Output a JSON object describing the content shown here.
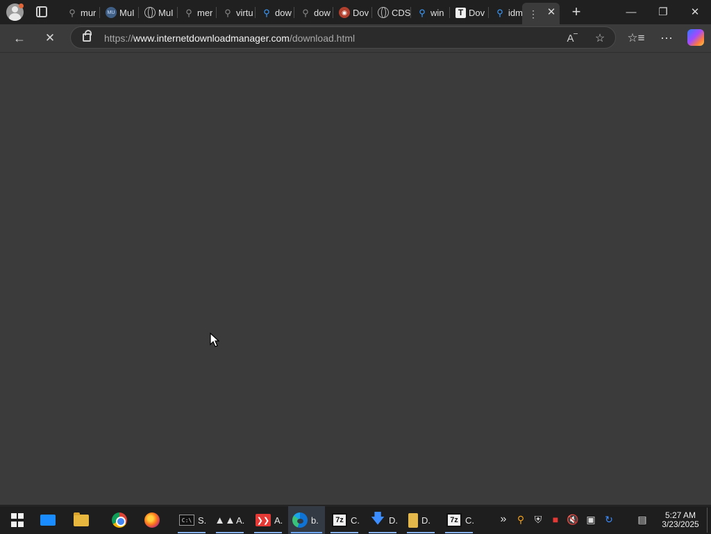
{
  "tabs": [
    {
      "label": "mur",
      "icon": "search-icon"
    },
    {
      "label": "MuI",
      "icon": "mu-logo-icon"
    },
    {
      "label": "MuI",
      "icon": "globe-icon"
    },
    {
      "label": "mer",
      "icon": "search-icon"
    },
    {
      "label": "virtu",
      "icon": "search-icon"
    },
    {
      "label": "dow",
      "icon": "search-icon"
    },
    {
      "label": "dow",
      "icon": "search-icon"
    },
    {
      "label": "Dov",
      "icon": "reddit-icon"
    },
    {
      "label": "CDS",
      "icon": "globe-icon"
    },
    {
      "label": "win",
      "icon": "search-icon"
    },
    {
      "label": "Dov",
      "icon": "t-logo-icon"
    },
    {
      "label": "idm",
      "icon": "search-icon"
    },
    {
      "label": "",
      "icon": "loading-icon"
    }
  ],
  "address": {
    "protocol": "https://",
    "host": "www.internetdownloadmanager.com",
    "path": "/download.html"
  },
  "taskbar": {
    "items": [
      {
        "label": "S.",
        "icon": "command-prompt-icon"
      },
      {
        "label": "A.",
        "icon": "aria-icon"
      },
      {
        "label": "A.",
        "icon": "anydesk-icon"
      },
      {
        "label": "b.",
        "icon": "edge-icon"
      },
      {
        "label": "C.",
        "icon": "7zip-icon"
      },
      {
        "label": "D.",
        "icon": "download-icon"
      },
      {
        "label": "D.",
        "icon": "archive-icon"
      },
      {
        "label": "C.",
        "icon": "7zip-icon"
      }
    ],
    "clock": {
      "time": "5:27 AM",
      "date": "3/23/2025"
    }
  },
  "colors": {
    "chrome": "#202020",
    "toolbar": "#3b3b3b",
    "content": "#3b3b3b",
    "taskbar": "#1e1e1e",
    "accent": "#3b9cff"
  }
}
